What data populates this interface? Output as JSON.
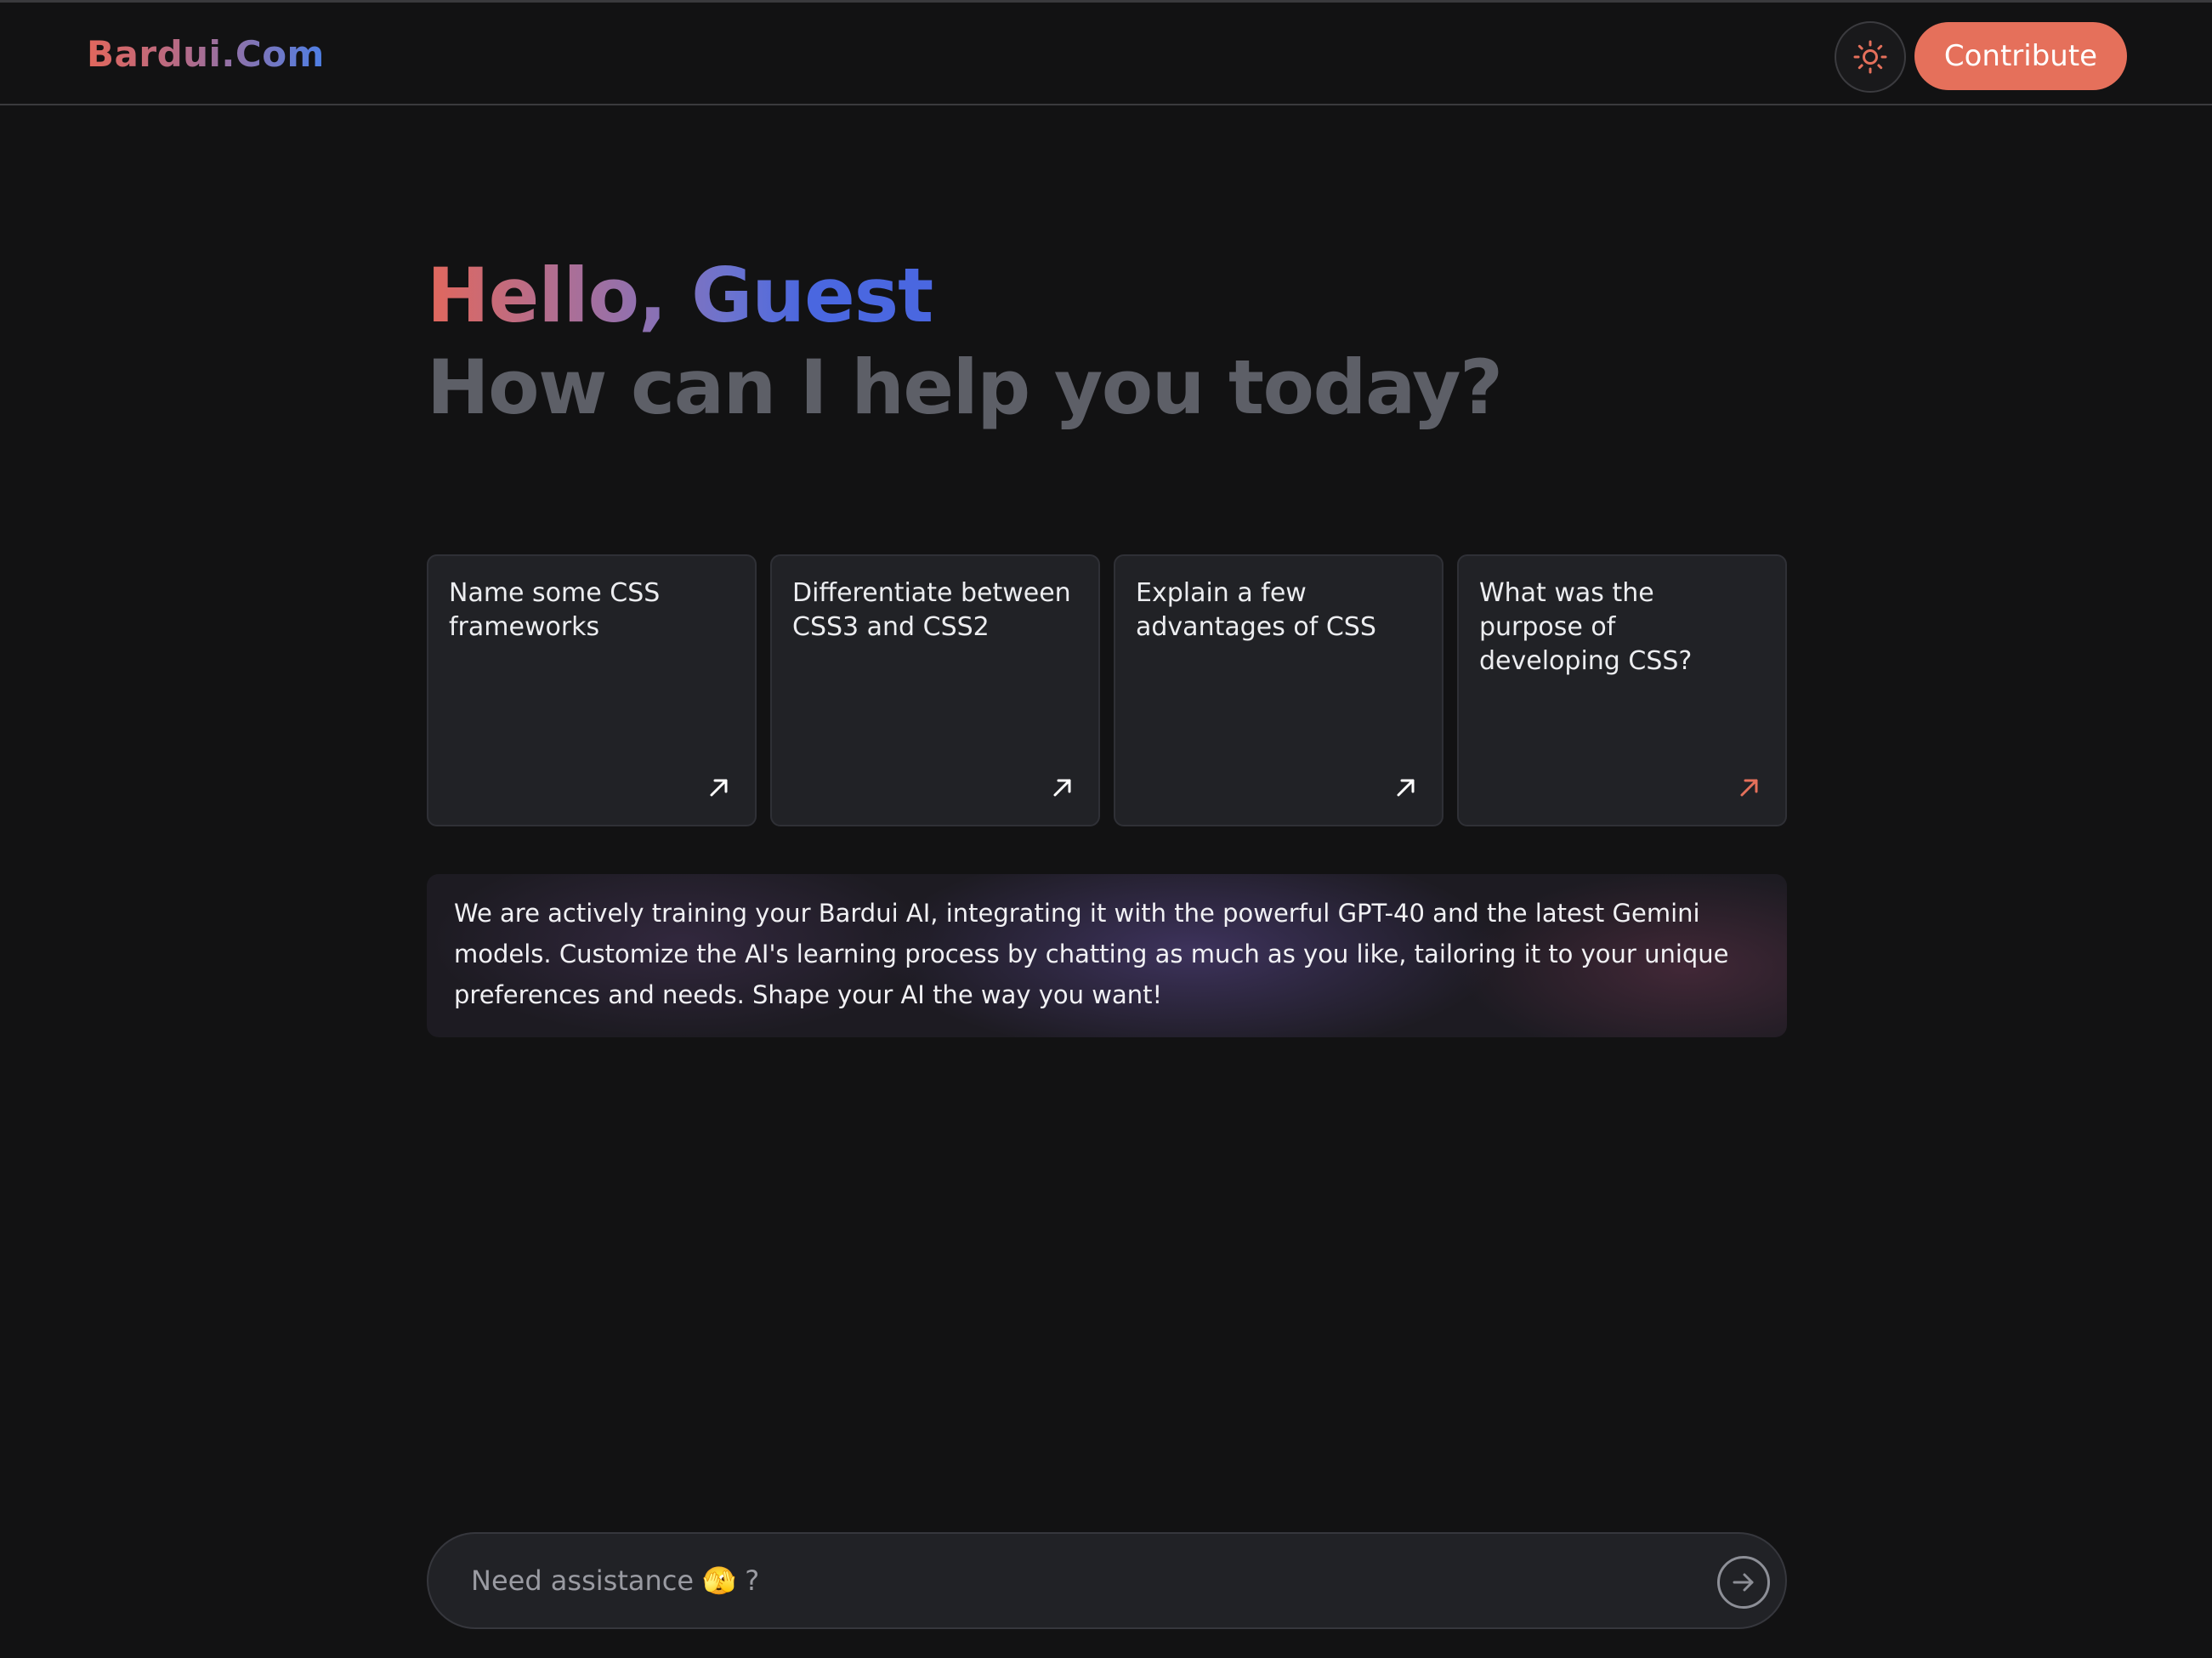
{
  "header": {
    "brand": "Bardui.Com",
    "contribute_label": "Contribute",
    "theme_icon": "sun-icon"
  },
  "greeting": {
    "hello": "Hello, Guest",
    "subtitle": "How can I help you today?"
  },
  "suggestions": [
    {
      "text": "Name some CSS frameworks",
      "icon": "arrow-up-right-icon"
    },
    {
      "text": "Differentiate between CSS3 and CSS2",
      "icon": "arrow-up-right-icon"
    },
    {
      "text": "Explain a few advantages of CSS",
      "icon": "arrow-up-right-icon"
    },
    {
      "text": "What was the purpose of developing CSS?",
      "icon": "arrow-up-right-icon"
    }
  ],
  "notice": {
    "text": "We are actively training your Bardui AI, integrating it with the powerful GPT-40 and the latest Gemini models. Customize the AI's learning process by chatting as much as you like, tailoring it to your unique preferences and needs. Shape your AI the way you want!"
  },
  "chat": {
    "placeholder": "Need assistance 🫣 ?",
    "value": "",
    "send_icon": "arrow-right-circle-icon"
  },
  "colors": {
    "background": "#121213",
    "accent": "#e5705b",
    "card": "#212226",
    "muted_heading": "#5d5f67",
    "active_arrow": "#e5705b"
  }
}
